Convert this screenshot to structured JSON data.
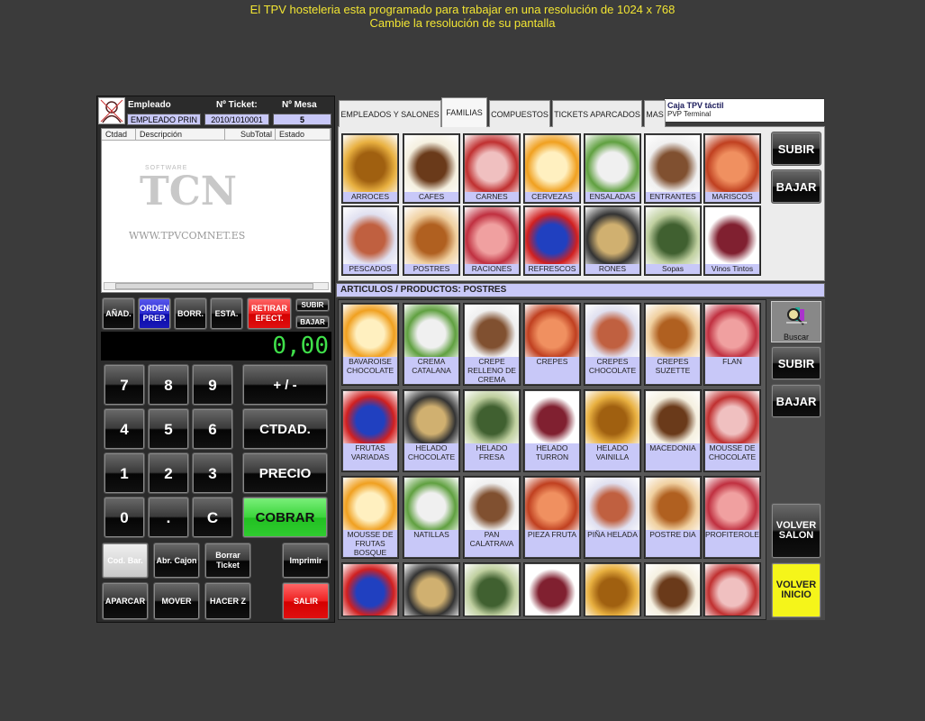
{
  "warning": {
    "line1": "El TPV hosteleria esta programado para trabajar en una resolución de 1024 x 768",
    "line2": "Cambie la resolución de su pantalla"
  },
  "header": {
    "employee_label": "Empleado",
    "ticket_label": "Nº Ticket:",
    "table_label": "Nº Mesa",
    "employee": "EMPLEADO PRIN",
    "ticket": "2010/1010001",
    "table": "5"
  },
  "ticket_columns": [
    "Ctdad",
    "Descripción",
    "SubTotal",
    "Estado"
  ],
  "watermark": {
    "brand": "TCN",
    "software": "SOFTWARE",
    "url": "WWW.TPVCOMNET.ES"
  },
  "actions": {
    "add": "AÑAD.",
    "order1": "ORDEN",
    "order2": "PREP.",
    "delete": "BORR.",
    "status": "ESTA.",
    "withdraw1": "RETIRAR",
    "withdraw2": "EFECT.",
    "up": "SUBIR",
    "down": "BAJAR"
  },
  "display": "0,00",
  "keypad": {
    "keys": [
      "7",
      "8",
      "9",
      "4",
      "5",
      "6",
      "1",
      "2",
      "3",
      "0",
      ".",
      "C"
    ],
    "plusminus": "+ / -",
    "qty": "CTDAD.",
    "price": "PRECIO",
    "charge": "COBRAR"
  },
  "bottom": {
    "barcode": "Cod. Bar.",
    "drawer": "Abr. Cajon",
    "del1": "Borrar",
    "del2": "Ticket",
    "print": "Imprimir",
    "park": "APARCAR",
    "move": "MOVER",
    "z": "HACER Z",
    "exit": "SALIR"
  },
  "tabs": [
    "EMPLEADOS Y SALONES",
    "FAMILIAS",
    "COMPUESTOS",
    "TICKETS APARCADOS",
    "MAS"
  ],
  "active_tab": "FAMILIAS",
  "tooltip": {
    "title": "Caja TPV táctil",
    "subtitle": "PVP Terminal"
  },
  "families": [
    "ARROCES",
    "CAFES",
    "CARNES",
    "CERVEZAS",
    "ENSALADAS",
    "ENTRANTES",
    "MARISCOS",
    "PESCADOS",
    "POSTRES",
    "RACIONES",
    "REFRESCOS",
    "RONES",
    "Sopas",
    "Vinos Tintos"
  ],
  "family_nav": {
    "up": "SUBIR",
    "down": "BAJAR"
  },
  "articles_header": "ARTICULOS / PRODUCTOS: POSTRES",
  "products": [
    "BAVAROISE CHOCOLATE",
    "CREMA CATALANA",
    "CREPE RELLENO DE CREMA",
    "CREPES",
    "CREPES CHOCOLATE",
    "CREPES SUZETTE",
    "FLAN",
    "FRUTAS VARIADAS",
    "HELADO CHOCOLATE",
    "HELADO FRESA",
    "HELADO TURRON",
    "HELADO VAINILLA",
    "MACEDONIA",
    "MOUSSE DE CHOCOLATE",
    "MOUSSE DE FRUTAS BOSQUE",
    "NATILLAS",
    "PAN CALATRAVA",
    "PIEZA FRUTA",
    "PIÑA HELADA",
    "POSTRE DIA",
    "PROFITEROLES",
    "",
    "",
    "",
    "",
    "",
    "",
    ""
  ],
  "product_nav": {
    "search": "Buscar",
    "up": "SUBIR",
    "down": "BAJAR",
    "back_room1": "VOLVER",
    "back_room2": "SALON",
    "back_home1": "VOLVER",
    "back_home2": "INICIO"
  },
  "colors": {
    "label_bg": "#c8c8f8",
    "display_green": "#3fe04a",
    "charge": "#3bd43b",
    "exit": "#e81818",
    "order": "#2222cc",
    "home": "#f5f51a"
  }
}
